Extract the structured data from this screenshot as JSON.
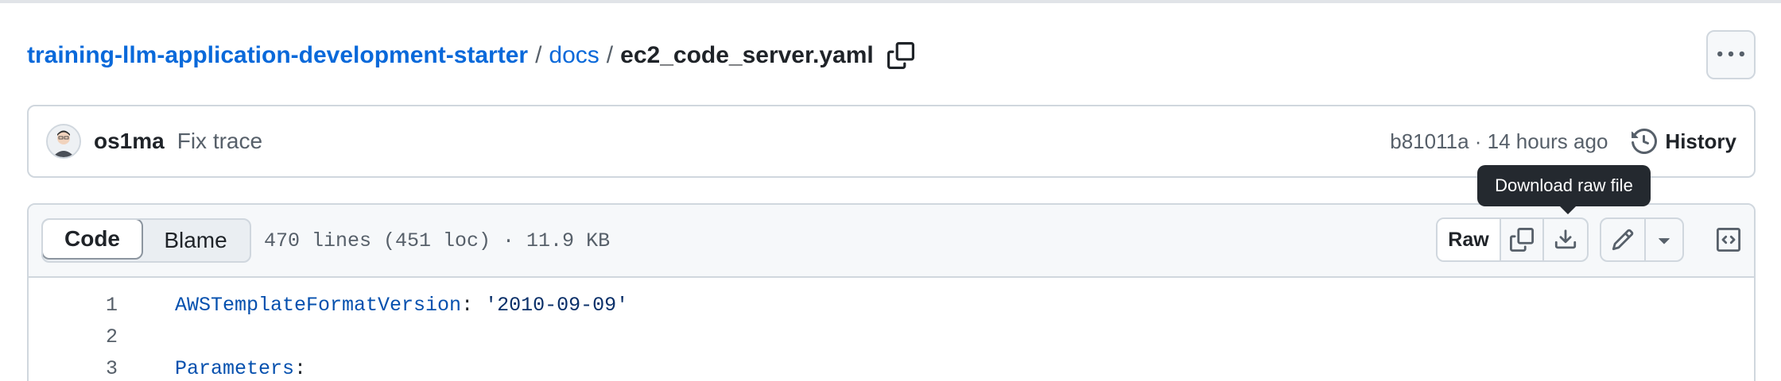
{
  "breadcrumb": {
    "repo": "training-llm-application-development-starter",
    "folder": "docs",
    "file": "ec2_code_server.yaml"
  },
  "commit": {
    "author": "os1ma",
    "message": "Fix trace",
    "meta": "b81011a · 14 hours ago",
    "history_label": "History"
  },
  "tooltip": {
    "text": "Download raw file"
  },
  "file_header": {
    "tabs": [
      {
        "label": "Code",
        "active": true
      },
      {
        "label": "Blame",
        "active": false
      }
    ],
    "info": "470 lines (451 loc) · 11.9 KB",
    "raw_label": "Raw"
  },
  "code": {
    "lines": [
      {
        "num": "1",
        "key": "AWSTemplateFormatVersion",
        "punct": ": ",
        "value": "'2010-09-09'"
      },
      {
        "num": "2",
        "key": "",
        "punct": "",
        "value": ""
      },
      {
        "num": "3",
        "key": "Parameters",
        "punct": ":",
        "value": ""
      }
    ]
  },
  "icons": {
    "copy_path": "copy-icon",
    "more": "kebab-horizontal-icon",
    "history": "history-icon",
    "copy_raw": "copy-icon",
    "download": "download-icon",
    "edit": "pencil-icon",
    "dropdown": "triangle-down-icon",
    "symbols": "code-square-icon"
  },
  "colors": {
    "link": "#0969da",
    "code_key": "#0550ae",
    "code_string": "#0a3069",
    "tooltip_bg": "#24292f"
  }
}
